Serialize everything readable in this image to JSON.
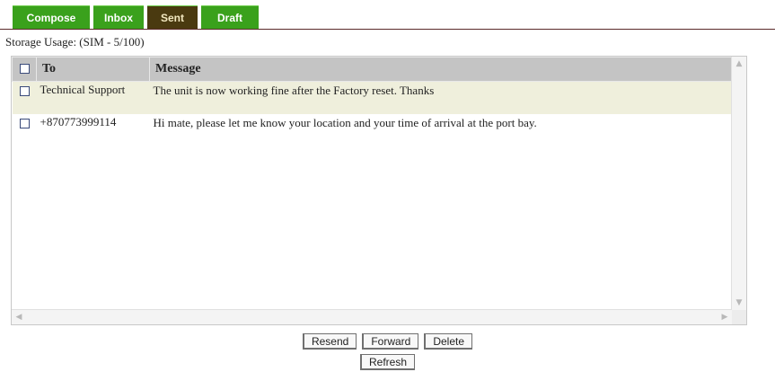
{
  "tabs": [
    {
      "label": "Compose"
    },
    {
      "label": "Inbox"
    },
    {
      "label": "Sent",
      "active": true
    },
    {
      "label": "Draft"
    }
  ],
  "storage_text": "Storage Usage: (SIM - 5/100)",
  "table": {
    "headers": {
      "to": "To",
      "message": "Message"
    },
    "rows": [
      {
        "to": "Technical Support",
        "message": "The unit is now working fine after the Factory reset. Thanks"
      },
      {
        "to": "+870773999114",
        "message": "Hi mate, please let me know your location and your time of arrival at the port bay."
      }
    ]
  },
  "buttons": {
    "resend": "Resend",
    "forward": "Forward",
    "delete": "Delete",
    "refresh": "Refresh"
  },
  "colors": {
    "tab_green": "#3aa11c",
    "tab_active": "#4a3a10",
    "header_gray": "#c4c4c4",
    "row_highlight": "#efefdc"
  }
}
